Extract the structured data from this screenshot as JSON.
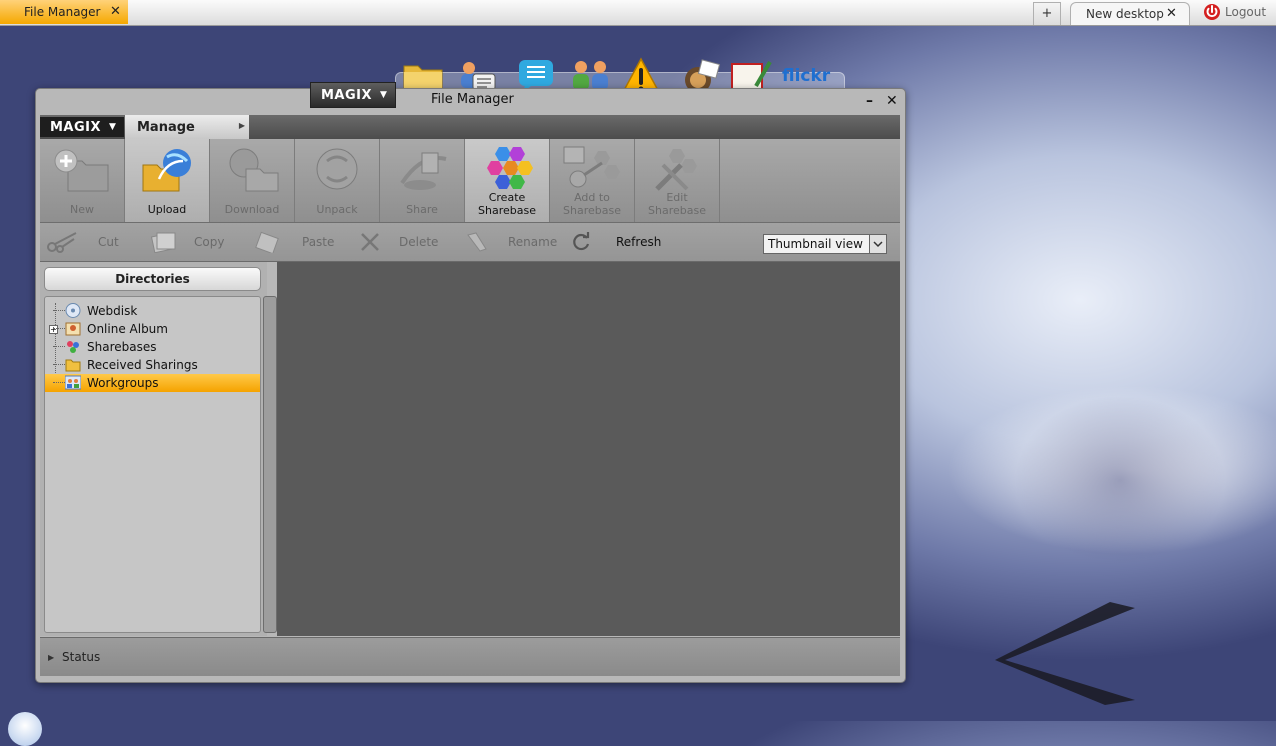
{
  "taskbar": {
    "active_tab": "File Manager",
    "close_symbol": "✕",
    "new_tab_symbol": "+",
    "desktop_tab": "New desktop",
    "logout": "Logout"
  },
  "dock": {
    "icons": [
      "folder-icon",
      "contacts-icon",
      "chat-icon",
      "users-icon",
      "warning-icon",
      "photo-edit-icon",
      "draw-icon",
      "flickr-icon"
    ],
    "flickr_text": "flickr"
  },
  "window": {
    "brand": "MAGIX",
    "title": "File Manager",
    "minimize": "–",
    "close": "✕"
  },
  "menu": {
    "brand": "MAGIX",
    "manage": "Manage"
  },
  "ribbon": {
    "new": "New",
    "upload": "Upload",
    "download": "Download",
    "unpack": "Unpack",
    "share": "Share",
    "create_sharebase_1": "Create",
    "create_sharebase_2": "Sharebase",
    "add_to_sharebase_1": "Add to",
    "add_to_sharebase_2": "Sharebase",
    "edit_sharebase_1": "Edit",
    "edit_sharebase_2": "Sharebase"
  },
  "toolbar": {
    "cut": "Cut",
    "copy": "Copy",
    "paste": "Paste",
    "delete": "Delete",
    "rename": "Rename",
    "refresh": "Refresh",
    "view_select": "Thumbnail view"
  },
  "directories": {
    "header": "Directories",
    "items": [
      "Webdisk",
      "Online Album",
      "Sharebases",
      "Received Sharings",
      "Workgroups"
    ],
    "selected": "Workgroups"
  },
  "status": {
    "label": "Status"
  },
  "colors": {
    "accent": "#f5a800",
    "window_bg": "#b8b8b8",
    "content_bg": "#5a5a5a"
  }
}
